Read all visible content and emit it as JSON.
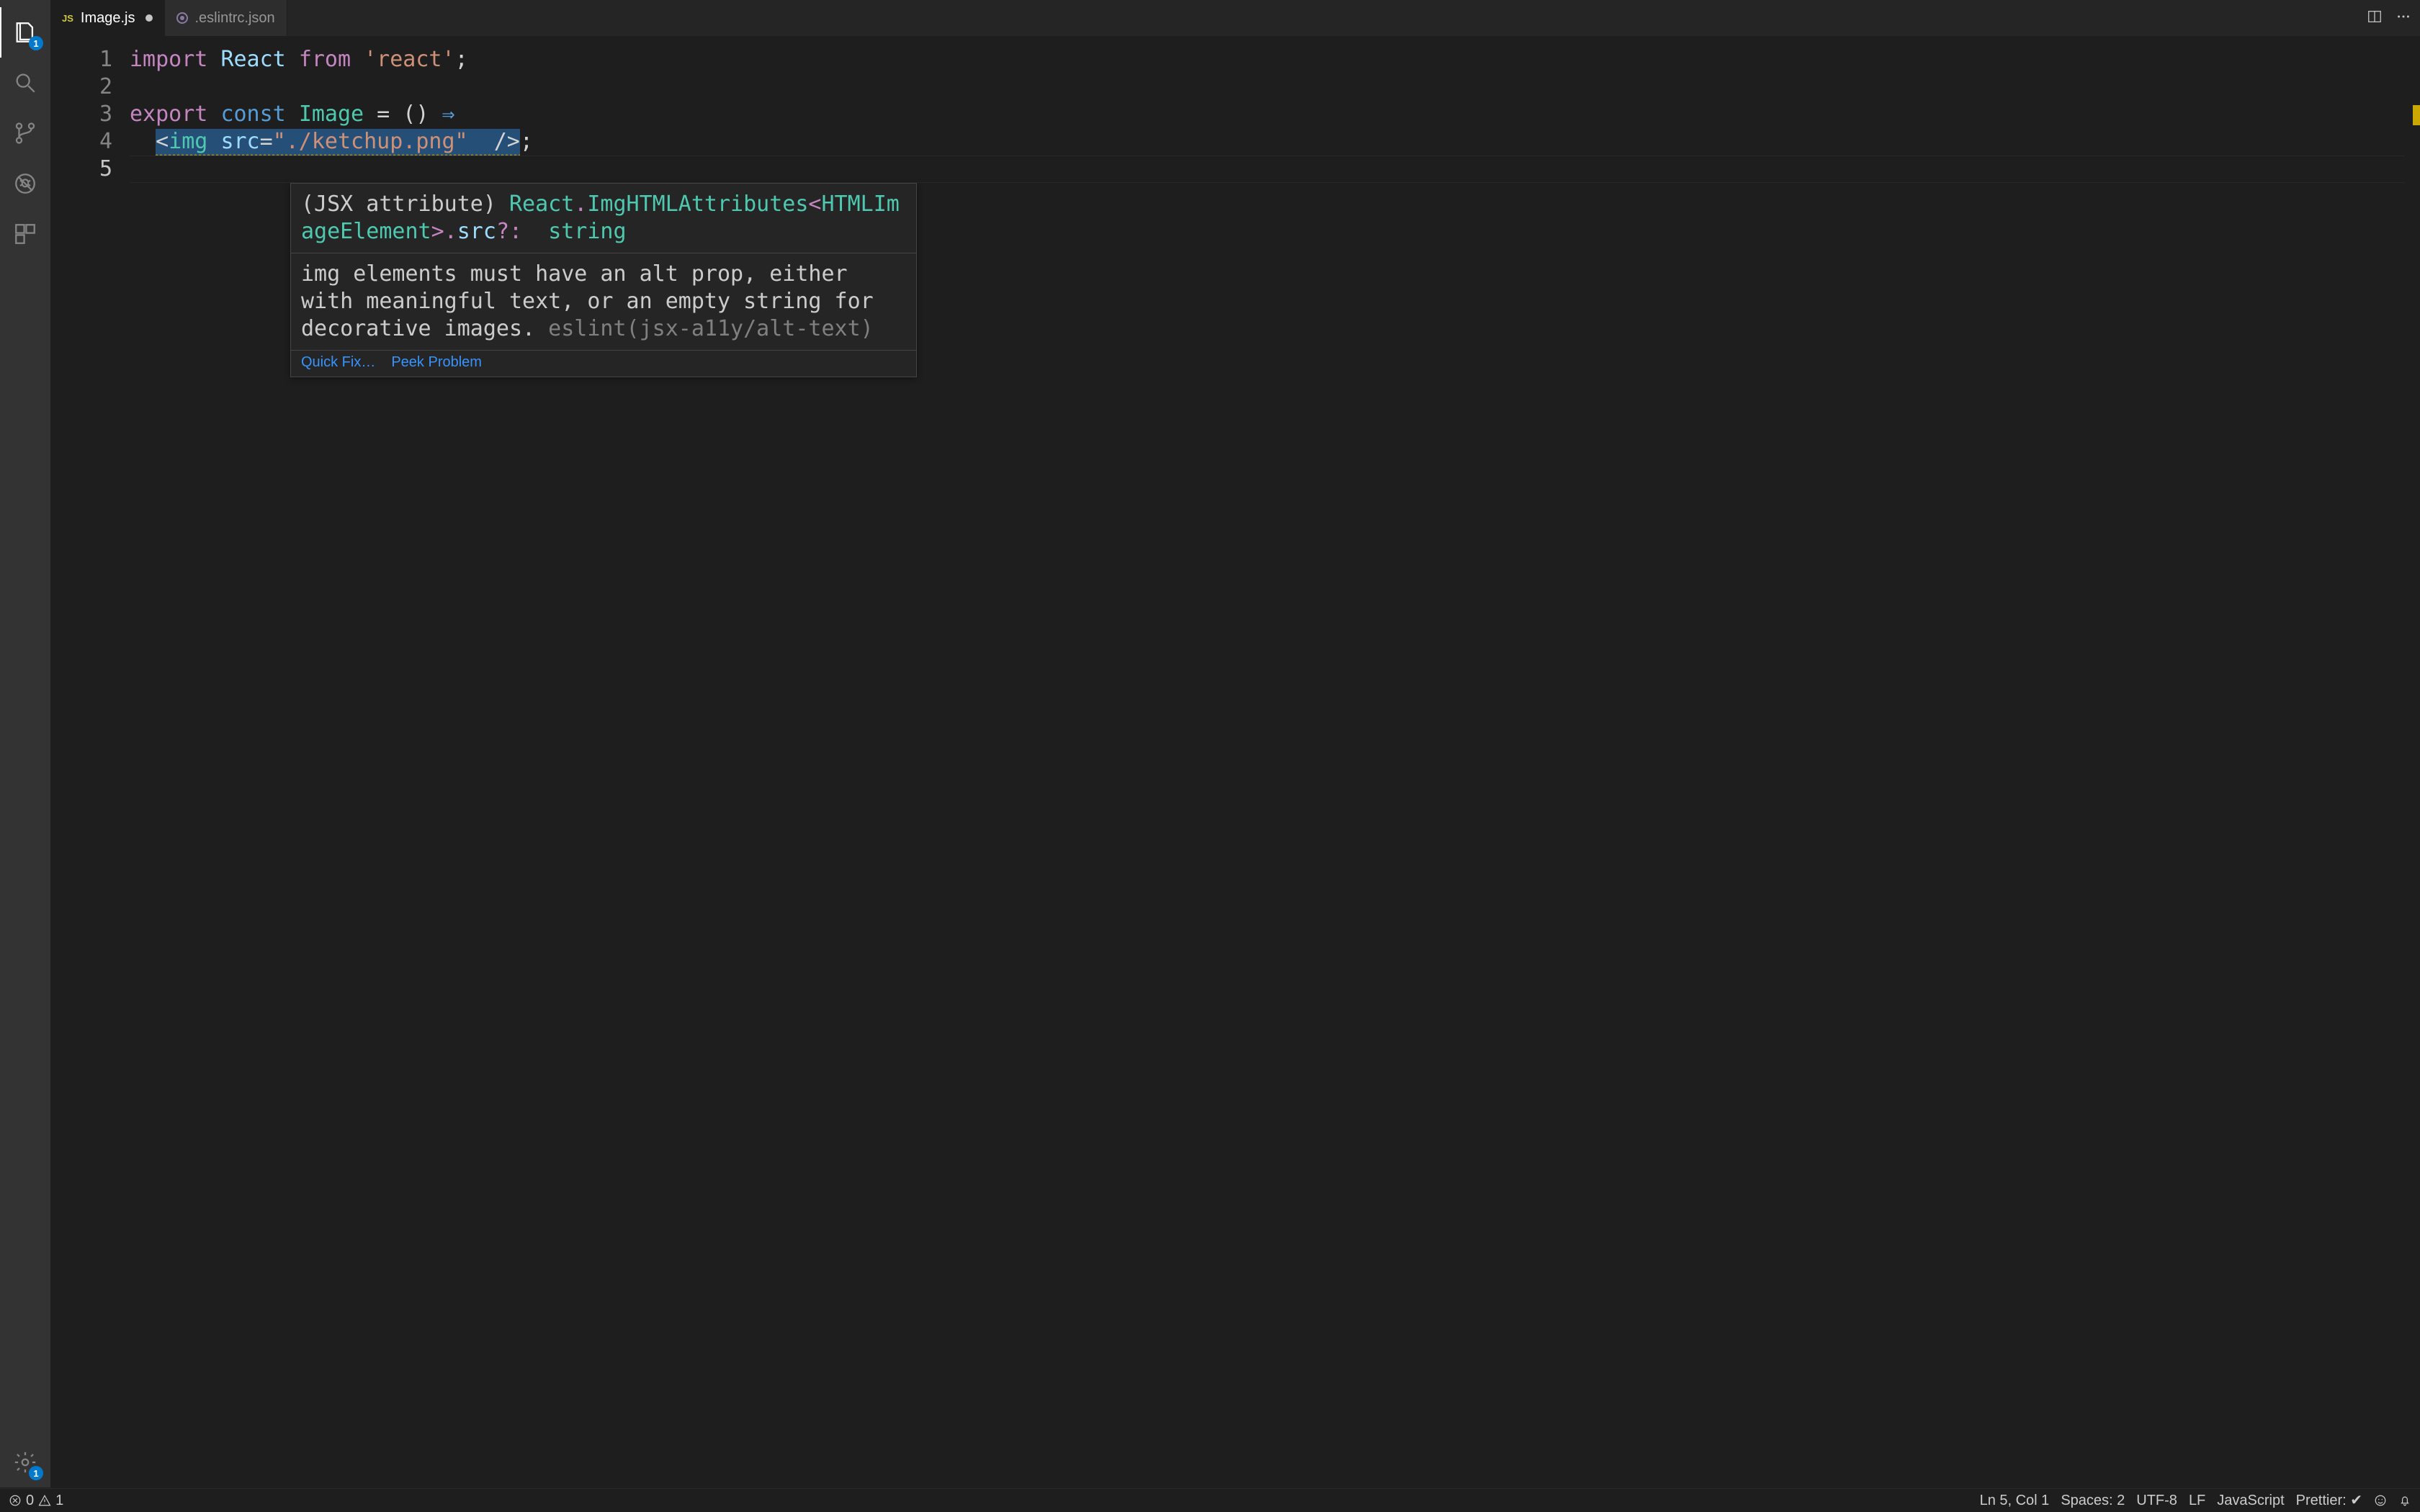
{
  "activity_bar": {
    "explorer_badge": "1",
    "settings_badge": "1"
  },
  "tabs": [
    {
      "icon": "js",
      "label": "Image.js",
      "dirty": true,
      "active": true
    },
    {
      "icon": "json",
      "label": ".eslintrc.json",
      "dirty": false,
      "active": false
    }
  ],
  "gutter": [
    "1",
    "2",
    "3",
    "4",
    "5"
  ],
  "code": {
    "line1": {
      "import": "import",
      "react": "React",
      "from": "from",
      "str": "'react'",
      "semi": ";"
    },
    "line3": {
      "export": "export",
      "const": "const",
      "name": "Image",
      "eq": " = () ",
      "arrow": "⇒"
    },
    "line4": {
      "indent": "  ",
      "open": "<",
      "tag": "img",
      "sp": " ",
      "attr": "src",
      "eq": "=",
      "val": "\"./ketchup.png\"",
      "sp2": "  ",
      "close": "/>",
      "semi": ";"
    }
  },
  "hover": {
    "sig_prefix": "(JSX attribute) ",
    "sig_react": "React",
    "sig_dot1": ".",
    "sig_attrtype": "ImgHTMLAttributes",
    "sig_lt": "<",
    "sig_elem": "HTMLImageElement",
    "sig_gt": ">",
    "sig_dot2": ".",
    "sig_prop": "src",
    "sig_opt": "?:",
    "sig_spc": "  ",
    "sig_string": "string",
    "lint_msg": "img elements must have an alt prop, either with meaningful text, or an empty string for decorative images. ",
    "lint_rule": "eslint(jsx-a11y/alt-text)",
    "action_fix": "Quick Fix…",
    "action_peek": "Peek Problem"
  },
  "status": {
    "errors": "0",
    "warnings": "1",
    "cursor": "Ln 5, Col 1",
    "spaces": "Spaces: 2",
    "encoding": "UTF-8",
    "eol": "LF",
    "lang": "JavaScript",
    "prettier": "Prettier: ✔"
  }
}
